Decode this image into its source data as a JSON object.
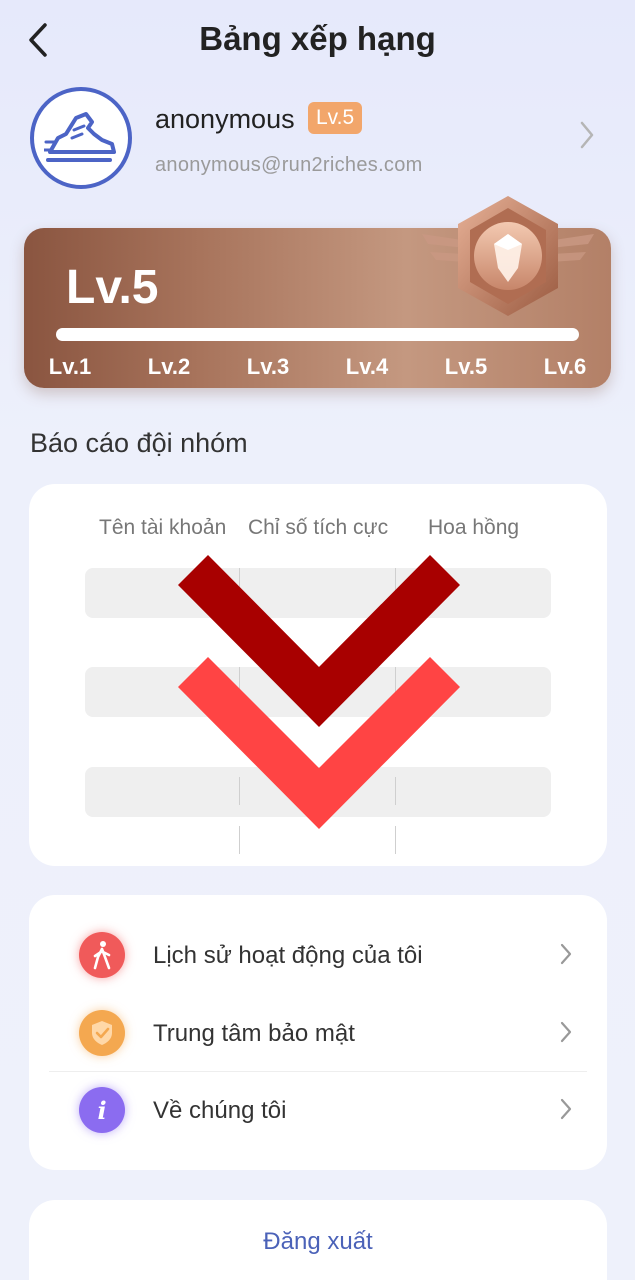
{
  "header": {
    "title": "Bảng xếp hạng"
  },
  "profile": {
    "username": "anonymous",
    "level_badge": "Lv.5",
    "email": "anonymous@run2riches.com"
  },
  "level_card": {
    "current_level": "Lv.5",
    "levels": [
      "Lv.1",
      "Lv.2",
      "Lv.3",
      "Lv.4",
      "Lv.5",
      "Lv.6"
    ],
    "medal_tier": "bronze"
  },
  "team_report": {
    "title": "Báo cáo đội nhóm",
    "columns": [
      "Tên tài khoản",
      "Chỉ số tích cực",
      "Hoa hồng"
    ]
  },
  "menu": {
    "items": [
      {
        "label": "Lịch sử hoạt động của tôi",
        "icon": "walking-person-icon",
        "color": "#f05a5a"
      },
      {
        "label": "Trung tâm bảo mật",
        "icon": "shield-check-icon",
        "color": "#f4a850"
      },
      {
        "label": "Về chúng tôi",
        "icon": "info-icon",
        "color": "#8b6cf0"
      }
    ]
  },
  "logout": {
    "label": "Đăng xuất"
  },
  "colors": {
    "accent": "#4b62b8",
    "level_badge": "#f2a66b",
    "overlay_dark_red": "#a80000",
    "overlay_red": "#ff4444"
  }
}
